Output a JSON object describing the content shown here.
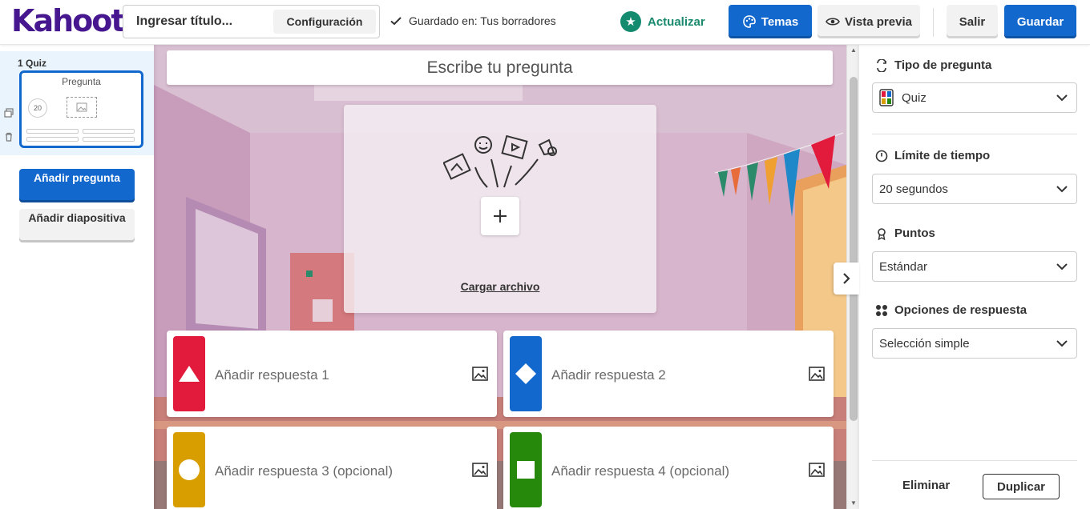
{
  "header": {
    "logo": "Kahoot!",
    "title_placeholder": "Ingresar título...",
    "config_label": "Configuración",
    "saved_text": "Guardado en: Tus borradores",
    "update_label": "Actualizar",
    "themes_label": "Temas",
    "preview_label": "Vista previa",
    "exit_label": "Salir",
    "save_label": "Guardar"
  },
  "sidebar": {
    "slide": {
      "number_label": "1  Quiz",
      "thumb_title": "Pregunta",
      "thumb_timer": "20"
    },
    "add_question_label": "Añadir pregunta",
    "add_slide_label": "Añadir diapositiva"
  },
  "editor": {
    "question_placeholder": "Escribe tu pregunta",
    "upload_label": "Cargar archivo",
    "answers": [
      {
        "text": "Añadir respuesta 1",
        "color": "#e21b3c",
        "shape": "triangle"
      },
      {
        "text": "Añadir respuesta 2",
        "color": "#1368ce",
        "shape": "diamond"
      },
      {
        "text": "Añadir respuesta 3 (opcional)",
        "color": "#d89e00",
        "shape": "circle"
      },
      {
        "text": "Añadir respuesta 4 (opcional)",
        "color": "#26890c",
        "shape": "square"
      }
    ]
  },
  "settings": {
    "question_type": {
      "label": "Tipo de pregunta",
      "value": "Quiz"
    },
    "time_limit": {
      "label": "Límite de tiempo",
      "value": "20 segundos"
    },
    "points": {
      "label": "Puntos",
      "value": "Estándar"
    },
    "answer_options": {
      "label": "Opciones de respuesta",
      "value": "Selección simple"
    },
    "delete_label": "Eliminar",
    "duplicate_label": "Duplicar"
  },
  "colors": {
    "brand": "#46178f",
    "primary_blue": "#1368ce",
    "update_green": "#148a6e"
  }
}
